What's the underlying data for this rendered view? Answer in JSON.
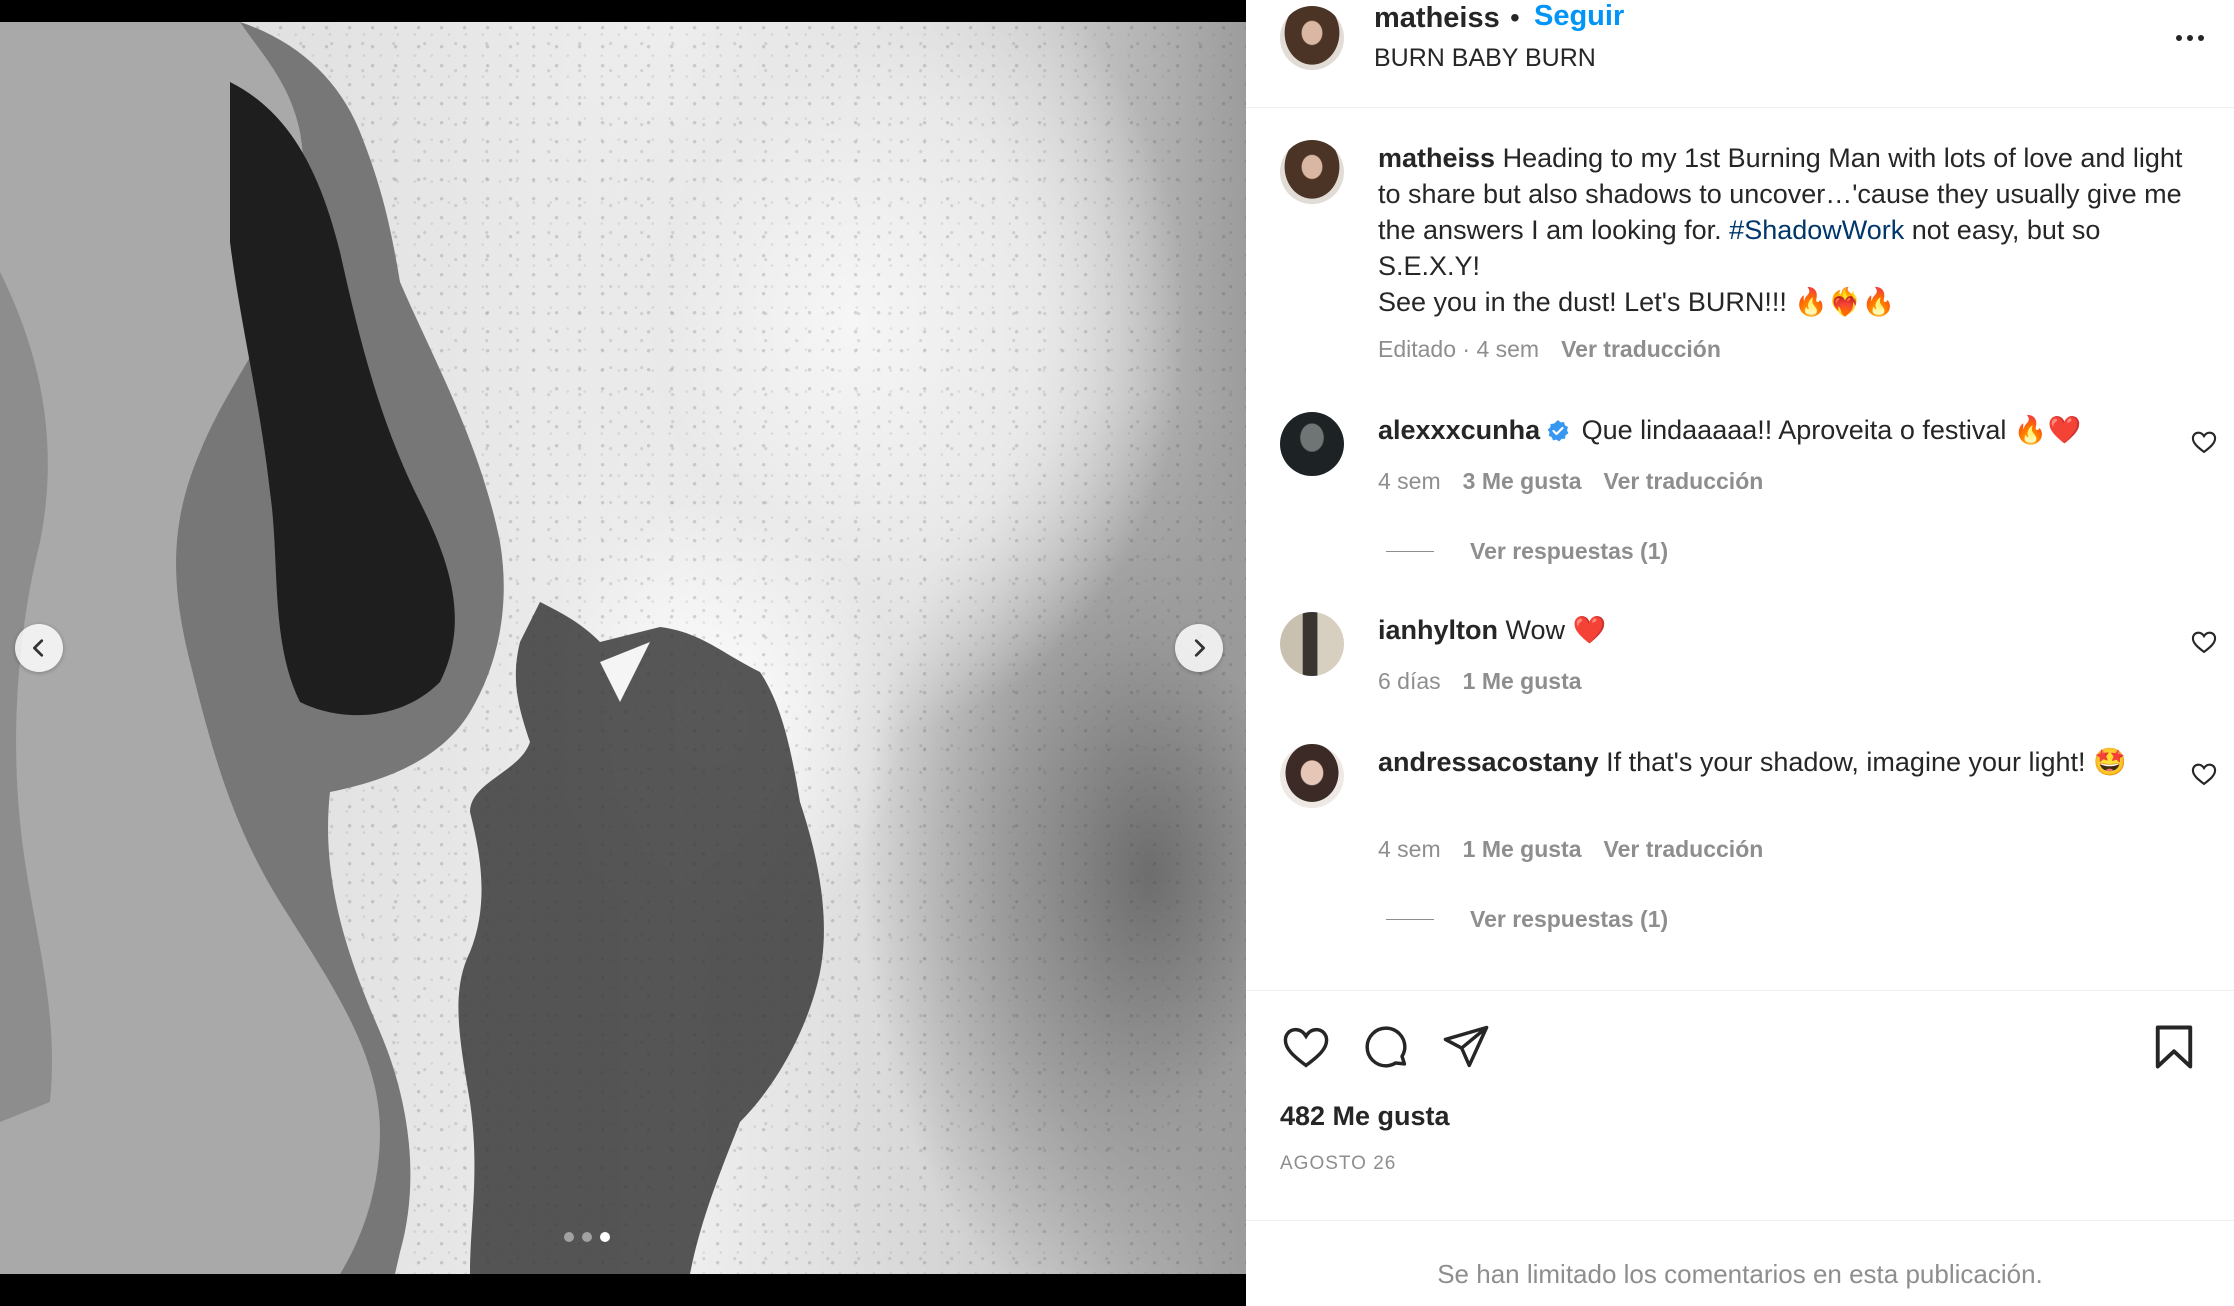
{
  "post": {
    "username": "matheiss",
    "separator": "•",
    "follow_label": "Seguir",
    "location": "BURN BABY BURN"
  },
  "caption": {
    "username": "matheiss",
    "text_part1": " Heading to my 1st Burning Man with lots of love and light to share but also shadows to uncover…'cause they usually give me the answers I am looking for. ",
    "hashtag": "#ShadowWork",
    "text_part2": " not easy, but so S.E.X.Y!",
    "line2": "See you in the dust! Let's BURN!!! 🔥❤️‍🔥🔥",
    "edited": "Editado · 4 sem",
    "translate": "Ver traducción"
  },
  "comments": [
    {
      "username": "alexxxcunha",
      "text": " Que lindaaaaa!! Aproveita o festival 🔥❤️",
      "time": "4 sem",
      "likes": "3 Me gusta",
      "translate": "Ver traducción",
      "replies": "Ver respuestas (1)"
    },
    {
      "username": "ianhylton",
      "text": " Wow ❤️",
      "time": "6 días",
      "likes": "1 Me gusta"
    },
    {
      "username": "andressacostany",
      "text": " If that's your shadow, imagine your light! 🤩",
      "time": "4 sem",
      "likes": "1 Me gusta",
      "translate": "Ver traducción",
      "replies": "Ver respuestas (1)"
    }
  ],
  "stats": {
    "likes": "482 Me gusta",
    "date": "AGOSTO 26"
  },
  "footer": {
    "notice": "Se han limitado los comentarios en esta publicación."
  },
  "carousel": {
    "total_slides": 3,
    "active_slide": 3
  },
  "icons": {
    "like": "heart-icon",
    "comment": "comment-icon",
    "share": "paper-plane-icon",
    "save": "bookmark-icon",
    "more": "more-icon",
    "verified": "verified-badge-icon",
    "prev": "chevron-left-icon",
    "next": "chevron-right-icon"
  },
  "colors": {
    "accent": "#0095f6",
    "hashtag": "#00376b",
    "secondary_text": "#8e8e8e",
    "verified": "#3897f0"
  }
}
